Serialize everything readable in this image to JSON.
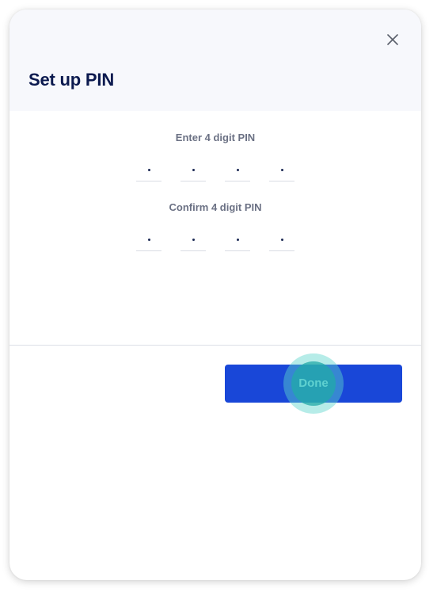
{
  "dialog": {
    "title": "Set up PIN"
  },
  "pin": {
    "enter_label": "Enter 4 digit PIN",
    "confirm_label": "Confirm 4 digit PIN",
    "enter_digits": [
      "•",
      "•",
      "•",
      "•"
    ],
    "confirm_digits": [
      "•",
      "•",
      "•",
      "•"
    ]
  },
  "footer": {
    "done_label": "Done"
  },
  "icons": {
    "close": "close-icon"
  },
  "colors": {
    "title": "#0c1a4f",
    "primary": "#1947d8",
    "ripple": "#5ed4cc",
    "header_bg": "#f7f8fc"
  }
}
